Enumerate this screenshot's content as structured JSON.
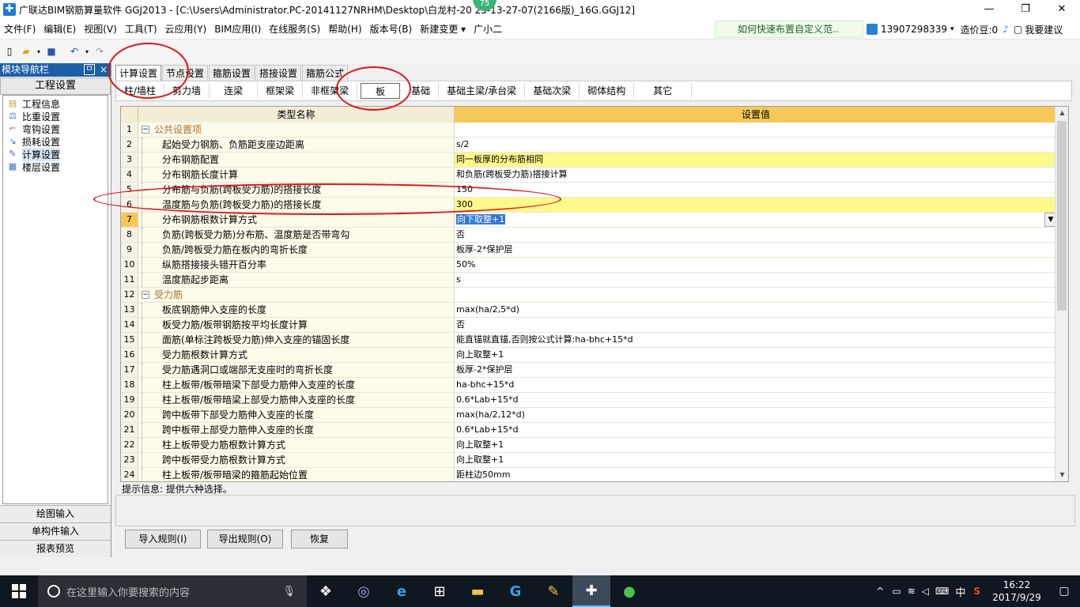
{
  "window": {
    "title": "广联达BIM钢筋算量软件 GGJ2013 - [C:\\Users\\Administrator.PC-20141127NRHM\\Desktop\\白龙村-20    25-13-27-07(2166版)_16G.GGJ12]",
    "badge": "75"
  },
  "menu": {
    "items": [
      "文件(F)",
      "编辑(E)",
      "视图(V)",
      "工具(T)",
      "云应用(Y)",
      "BIM应用(I)",
      "在线服务(S)",
      "帮助(H)",
      "版本号(B)",
      "新建变更 ▾",
      "广小二"
    ],
    "tip": "如何快速布置自定义范..",
    "phone": "13907298339",
    "coins": "造价豆:0",
    "suggest": "我要建议"
  },
  "nav": {
    "header": "模块导航栏",
    "pin": "ㅁ",
    "close": "×",
    "section_title": "工程设置",
    "items": [
      {
        "label": "工程信息",
        "icon": "info-icon"
      },
      {
        "label": "比重设置",
        "icon": "weight-icon"
      },
      {
        "label": "弯钩设置",
        "icon": "hook-icon"
      },
      {
        "label": "损耗设置",
        "icon": "loss-icon"
      },
      {
        "label": "计算设置",
        "icon": "calc-icon"
      },
      {
        "label": "楼层设置",
        "icon": "floor-icon"
      }
    ],
    "bottom": [
      "绘图输入",
      "单构件输入",
      "报表预览"
    ]
  },
  "tabs": {
    "main": [
      "计算设置",
      "节点设置",
      "箍筋设置",
      "搭接设置",
      "箍筋公式"
    ],
    "sub": [
      "柱/墙柱",
      "剪力墙",
      "连梁",
      "框架梁",
      "非框架梁",
      "板",
      "基础",
      "基础主梁/承台梁",
      "基础次梁",
      "砌体结构",
      "其它"
    ]
  },
  "grid": {
    "col_name": "类型名称",
    "col_value": "设置值",
    "rows": [
      {
        "no": "1",
        "name": "公共设置项",
        "value": "",
        "group": true
      },
      {
        "no": "2",
        "name": "起始受力钢筋、负筋距支座边距离",
        "value": "s/2"
      },
      {
        "no": "3",
        "name": "分布钢筋配置",
        "value": "同一板厚的分布筋相同",
        "hl": true
      },
      {
        "no": "4",
        "name": "分布钢筋长度计算",
        "value": "和负筋(跨板受力筋)搭接计算"
      },
      {
        "no": "5",
        "name": "分布筋与负筋(跨板受力筋)的搭接长度",
        "value": "150"
      },
      {
        "no": "6",
        "name": "温度筋与负筋(跨板受力筋)的搭接长度",
        "value": "300",
        "hl": true
      },
      {
        "no": "7",
        "name": "分布钢筋根数计算方式",
        "value": "向下取整+1",
        "current": true
      },
      {
        "no": "8",
        "name": "负筋(跨板受力筋)分布筋、温度筋是否带弯勾",
        "value": "否"
      },
      {
        "no": "9",
        "name": "负筋/跨板受力筋在板内的弯折长度",
        "value": "板厚-2*保护层"
      },
      {
        "no": "10",
        "name": "纵筋搭接接头错开百分率",
        "value": "50%"
      },
      {
        "no": "11",
        "name": "温度筋起步距离",
        "value": "s"
      },
      {
        "no": "12",
        "name": "受力筋",
        "value": "",
        "group": true
      },
      {
        "no": "13",
        "name": "板底钢筋伸入支座的长度",
        "value": "max(ha/2,5*d)"
      },
      {
        "no": "14",
        "name": "板受力筋/板带钢筋按平均长度计算",
        "value": "否"
      },
      {
        "no": "15",
        "name": "面筋(单标注跨板受力筋)伸入支座的锚固长度",
        "value": "能直锚就直锚,否则按公式计算:ha-bhc+15*d"
      },
      {
        "no": "16",
        "name": "受力筋根数计算方式",
        "value": "向上取整+1"
      },
      {
        "no": "17",
        "name": "受力筋遇洞口或端部无支座时的弯折长度",
        "value": "板厚-2*保护层"
      },
      {
        "no": "18",
        "name": "柱上板带/板带暗梁下部受力筋伸入支座的长度",
        "value": "ha-bhc+15*d"
      },
      {
        "no": "19",
        "name": "柱上板带/板带暗梁上部受力筋伸入支座的长度",
        "value": "0.6*Lab+15*d"
      },
      {
        "no": "20",
        "name": "跨中板带下部受力筋伸入支座的长度",
        "value": "max(ha/2,12*d)"
      },
      {
        "no": "21",
        "name": "跨中板带上部受力筋伸入支座的长度",
        "value": "0.6*Lab+15*d"
      },
      {
        "no": "22",
        "name": "柱上板带受力筋根数计算方式",
        "value": "向上取整+1"
      },
      {
        "no": "23",
        "name": "跨中板带受力筋根数计算方式",
        "value": "向上取整+1"
      },
      {
        "no": "24",
        "name": "柱上板带/板带暗梁的箍筋起始位置",
        "value": "距柱边50mm"
      }
    ]
  },
  "hint": "提示信息: 提供六种选择。",
  "buttons": {
    "import": "导入规则(I)",
    "export": "导出规则(O)",
    "restore": "恢复"
  },
  "taskbar": {
    "search_placeholder": "在这里输入你要搜索的内容",
    "ime": "中",
    "time": "16:22",
    "date": "2017/9/29"
  },
  "colors": {
    "annotation": "#e0141a",
    "header_orange": "#f6c85a",
    "highlight_yellow": "#fff98c"
  }
}
